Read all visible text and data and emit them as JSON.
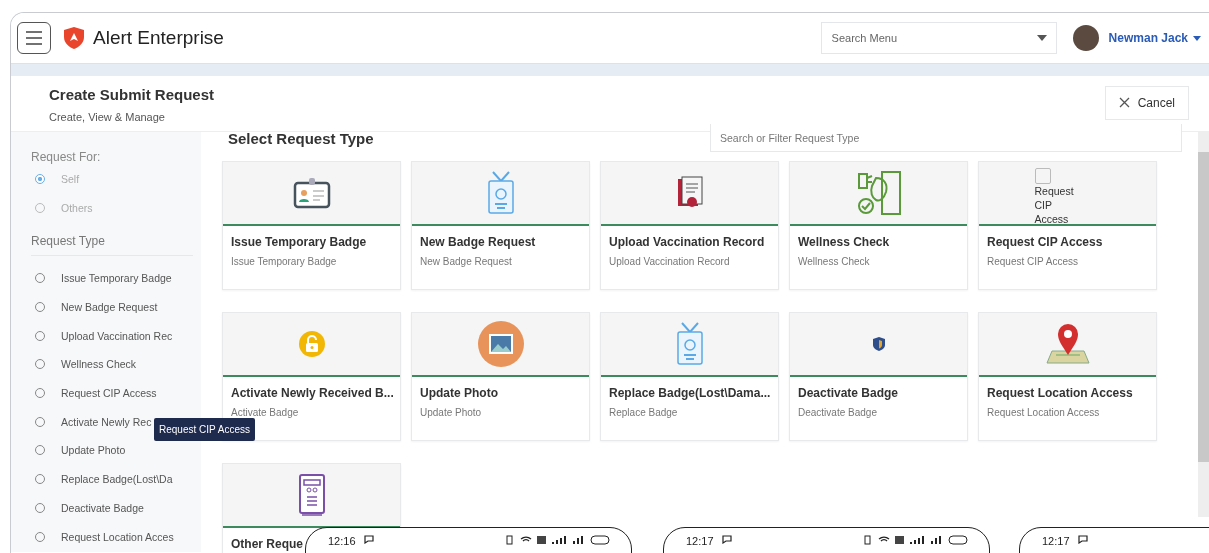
{
  "header": {
    "app_name": "Alert Enterprise",
    "search": {
      "placeholder": "Search Menu"
    },
    "user_name": "Newman Jack"
  },
  "page": {
    "title": "Create Submit Request",
    "subtitle": "Create, View & Manage",
    "cancel": "Cancel"
  },
  "sidebar": {
    "request_for_label": "Request For:",
    "request_for": [
      {
        "label": "Self",
        "selected": true
      },
      {
        "label": "Others",
        "selected": false
      }
    ],
    "request_type_label": "Request Type",
    "request_types": [
      {
        "label": "Issue Temporary Badge",
        "selected": false
      },
      {
        "label": "New Badge Request",
        "selected": false
      },
      {
        "label": "Upload Vaccination Rec",
        "selected": false
      },
      {
        "label": "Wellness Check",
        "selected": false
      },
      {
        "label": "Request CIP Access",
        "selected": false
      },
      {
        "label": "Activate Newly Rec",
        "selected": false
      },
      {
        "label": "Update Photo",
        "selected": false
      },
      {
        "label": "Replace Badge(Lost\\Da",
        "selected": false
      },
      {
        "label": "Deactivate Badge",
        "selected": false
      },
      {
        "label": "Request Location Acces",
        "selected": false
      }
    ],
    "tooltip": "Request CIP Access"
  },
  "main": {
    "title": "Select Request Type",
    "search": {
      "placeholder": "Search or Filter Request Type"
    },
    "cards": [
      {
        "kind": "badge",
        "title": "Issue Temporary Badge",
        "subtitle": "Issue Temporary Badge"
      },
      {
        "kind": "lanyard",
        "title": "New Badge Request",
        "subtitle": "New Badge Request"
      },
      {
        "kind": "document",
        "title": "Upload Vaccination Record",
        "subtitle": "Upload Vaccination Record"
      },
      {
        "kind": "wellness",
        "title": "Wellness Check",
        "subtitle": "Wellness Check"
      },
      {
        "kind": "broken",
        "icon_alt": "Request CIP Access",
        "title": "Request CIP Access",
        "subtitle": "Request CIP Access"
      },
      {
        "kind": "lock",
        "title": "Activate Newly Received B...",
        "subtitle": "Activate Badge"
      },
      {
        "kind": "photo",
        "title": "Update Photo",
        "subtitle": "Update Photo"
      },
      {
        "kind": "lanyard",
        "title": "Replace Badge(Lost\\Dama...",
        "subtitle": "Replace Badge"
      },
      {
        "kind": "shield",
        "title": "Deactivate Badge",
        "subtitle": "Deactivate Badge"
      },
      {
        "kind": "pin",
        "title": "Request Location Access",
        "subtitle": "Request Location Access"
      },
      {
        "kind": "device",
        "title": "Other Reque"
      }
    ]
  },
  "phones": [
    {
      "time": "12:16"
    },
    {
      "time": "12:17"
    },
    {
      "time": "12:17"
    }
  ]
}
